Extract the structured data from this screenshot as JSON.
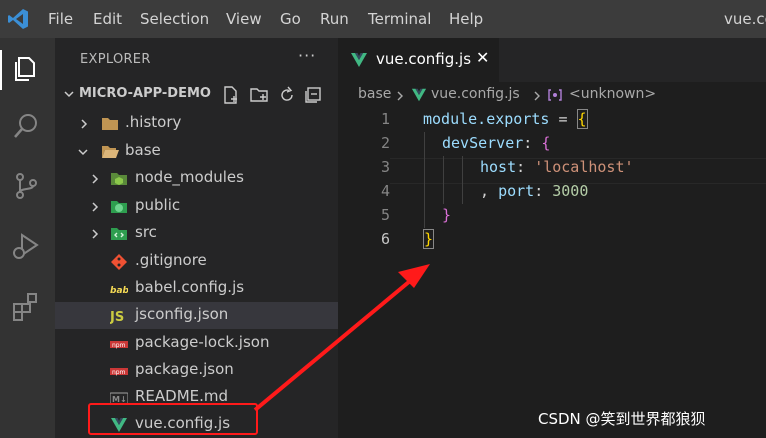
{
  "menubar": {
    "items": [
      "File",
      "Edit",
      "Selection",
      "View",
      "Go",
      "Run",
      "Terminal",
      "Help"
    ],
    "window_title": "vue.co"
  },
  "explorer": {
    "title": "EXPLORER",
    "more": "···",
    "project_name": "MICRO-APP-DEMO",
    "tree": [
      {
        "label": ".history",
        "type": "folder",
        "expanded": false
      },
      {
        "label": "base",
        "type": "folder",
        "expanded": true
      },
      {
        "label": "node_modules",
        "type": "folder",
        "expanded": false
      },
      {
        "label": "public",
        "type": "folder",
        "expanded": false
      },
      {
        "label": "src",
        "type": "folder",
        "expanded": false
      },
      {
        "label": ".gitignore",
        "type": "file"
      },
      {
        "label": "babel.config.js",
        "type": "file"
      },
      {
        "label": "jsconfig.json",
        "type": "file"
      },
      {
        "label": "package-lock.json",
        "type": "file"
      },
      {
        "label": "package.json",
        "type": "file"
      },
      {
        "label": "README.md",
        "type": "file"
      },
      {
        "label": "vue.config.js",
        "type": "file"
      }
    ]
  },
  "editor": {
    "tab_label": "vue.config.js",
    "close_glyph": "✕",
    "breadcrumb": [
      "base",
      "vue.config.js",
      "<unknown>"
    ],
    "line_numbers": [
      "1",
      "2",
      "3",
      "4",
      "5",
      "6"
    ],
    "code": {
      "l1_a": "module.exports",
      "l1_b": " = ",
      "l1_c": "{",
      "l2_a": "devServer",
      "l2_b": ": ",
      "l2_c": "{",
      "l3_a": "host",
      "l3_b": ": ",
      "l3_c": "'localhost'",
      "l4_a": ", ",
      "l4_b": "port",
      "l4_c": ": ",
      "l4_d": "3000",
      "l5_a": "}",
      "l6_a": "}"
    }
  },
  "watermark": "CSDN @笑到世界都狼狈",
  "colors": {
    "vue_green": "#41b883",
    "annotation_red": "#ff1a1a",
    "string": "#ce9178",
    "number": "#b5cea8",
    "variable": "#9cdcfe"
  }
}
